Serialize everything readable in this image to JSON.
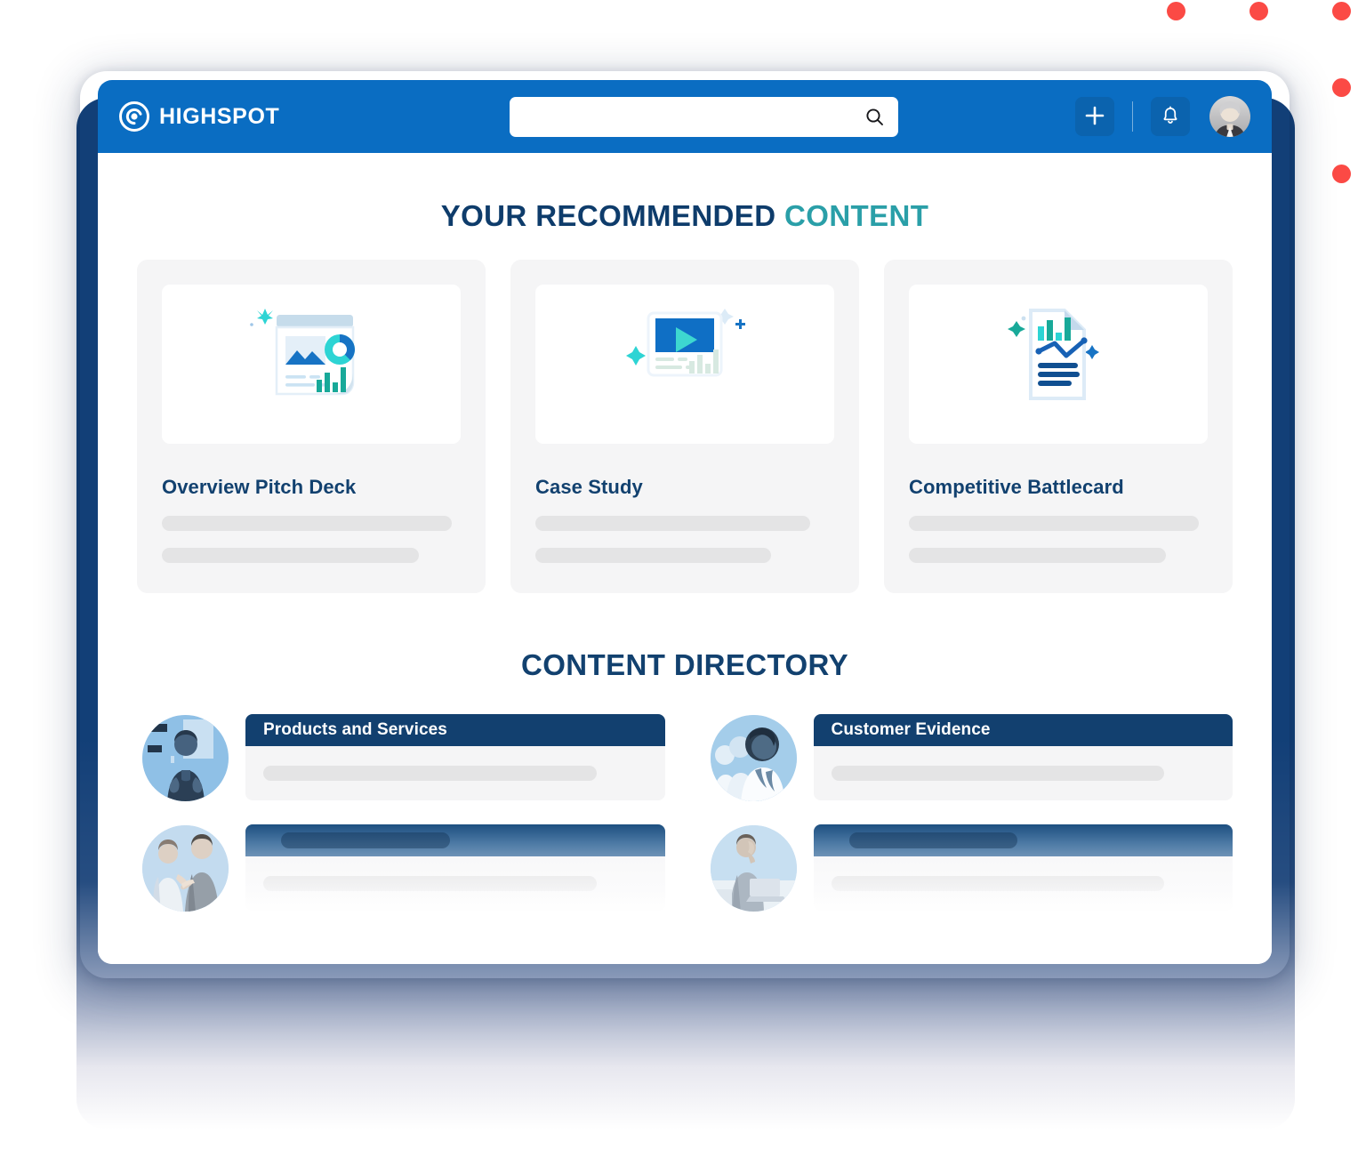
{
  "brand": {
    "name": "HIGHSPOT",
    "logo_icon": "highspot-spiral-logo"
  },
  "topbar": {
    "search": {
      "value": "",
      "placeholder": "",
      "icon": "search-icon"
    },
    "add_button_icon": "plus-icon",
    "notifications_icon": "bell-icon",
    "avatar_icon": "user-avatar-photo",
    "background_color": "#0A6DC2"
  },
  "recommended": {
    "heading_primary": "YOUR RECOMMENDED",
    "heading_accent": "CONTENT",
    "accent_color": "#2A9FA8",
    "heading_color": "#0E3C6B",
    "cards": [
      {
        "title": "Overview Pitch Deck",
        "thumbnail_icon": "document-with-chart-thumbnail"
      },
      {
        "title": "Case Study",
        "thumbnail_icon": "video-play-thumbnail"
      },
      {
        "title": "Competitive Battlecard",
        "thumbnail_icon": "report-page-thumbnail"
      }
    ]
  },
  "directory": {
    "heading": "CONTENT DIRECTORY",
    "heading_color": "#12416F",
    "rows": [
      {
        "title": "Products and Services",
        "avatar_icon": "presenter-photo",
        "faded": false
      },
      {
        "title": "Customer Evidence",
        "avatar_icon": "customers-group-photo",
        "faded": false
      },
      {
        "title": "",
        "avatar_icon": "handshake-photo",
        "faded": true
      },
      {
        "title": "",
        "avatar_icon": "man-on-phone-photo",
        "faded": true
      }
    ]
  },
  "decor": {
    "dot_color": "#FB4A45",
    "device_frame_color": "#123F77"
  }
}
